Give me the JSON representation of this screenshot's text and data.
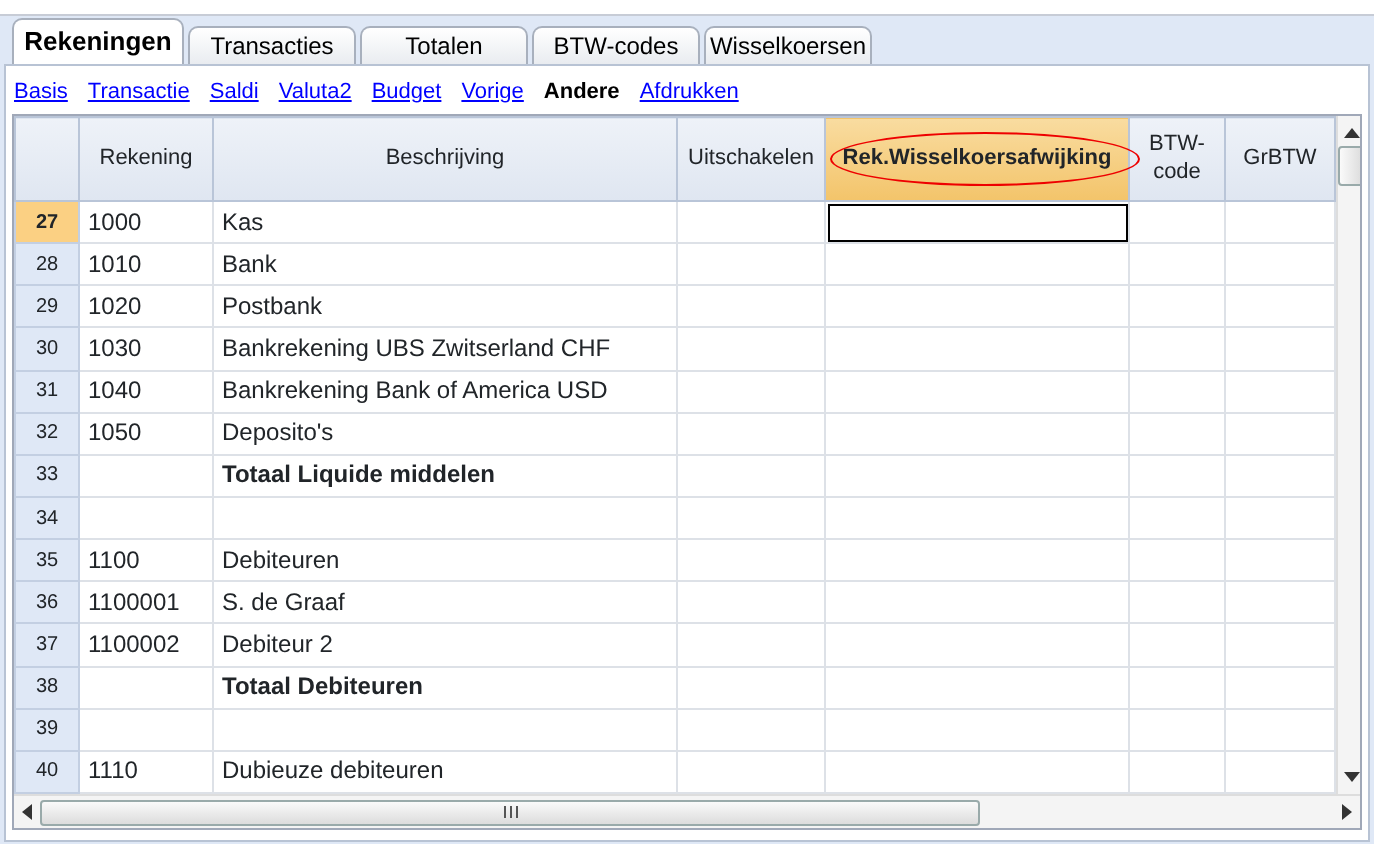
{
  "tabs": [
    {
      "label": "Rekeningen",
      "selected": true
    },
    {
      "label": "Transacties",
      "selected": false
    },
    {
      "label": "Totalen",
      "selected": false
    },
    {
      "label": "BTW-codes",
      "selected": false
    },
    {
      "label": "Wisselkoersen",
      "selected": false
    }
  ],
  "views": [
    {
      "label": "Basis",
      "selected": false
    },
    {
      "label": "Transactie",
      "selected": false
    },
    {
      "label": "Saldi",
      "selected": false
    },
    {
      "label": "Valuta2",
      "selected": false
    },
    {
      "label": "Budget",
      "selected": false
    },
    {
      "label": "Vorige",
      "selected": false
    },
    {
      "label": "Andere",
      "selected": true
    },
    {
      "label": "Afdrukken",
      "selected": false
    }
  ],
  "table": {
    "columns": [
      {
        "label": "Rekening",
        "selected": false,
        "highlighted": false
      },
      {
        "label": "Beschrijving",
        "selected": false,
        "highlighted": false
      },
      {
        "label": "Uitschakelen",
        "selected": false,
        "highlighted": false
      },
      {
        "label": "Rek.Wisselkoersafwijking",
        "selected": true,
        "highlighted": true
      },
      {
        "label": "BTW-\ncode",
        "selected": false,
        "highlighted": false
      },
      {
        "label": "GrBTW",
        "selected": false,
        "highlighted": false
      }
    ],
    "rows": [
      {
        "number": "27",
        "account": "1000",
        "description": "Kas",
        "kind": "normal",
        "selected": true
      },
      {
        "number": "28",
        "account": "1010",
        "description": "Bank",
        "kind": "normal",
        "selected": false
      },
      {
        "number": "29",
        "account": "1020",
        "description": "Postbank",
        "kind": "normal",
        "selected": false
      },
      {
        "number": "30",
        "account": "1030",
        "description": "Bankrekening UBS Zwitserland CHF",
        "kind": "normal",
        "selected": false
      },
      {
        "number": "31",
        "account": "1040",
        "description": "Bankrekening Bank of America USD",
        "kind": "normal",
        "selected": false
      },
      {
        "number": "32",
        "account": "1050",
        "description": "Deposito's",
        "kind": "normal",
        "selected": false
      },
      {
        "number": "33",
        "account": "",
        "description": "Totaal Liquide middelen",
        "kind": "total",
        "selected": false
      },
      {
        "number": "34",
        "account": "",
        "description": "",
        "kind": "normal",
        "selected": false
      },
      {
        "number": "35",
        "account": "1100",
        "description": "Debiteuren",
        "kind": "normal",
        "selected": false
      },
      {
        "number": "36",
        "account": "1100001",
        "description": "S. de Graaf",
        "kind": "normal",
        "selected": false
      },
      {
        "number": "37",
        "account": "1100002",
        "description": "Debiteur 2",
        "kind": "normal",
        "selected": false
      },
      {
        "number": "38",
        "account": "",
        "description": "Totaal Debiteuren",
        "kind": "total",
        "selected": false
      },
      {
        "number": "39",
        "account": "",
        "description": "",
        "kind": "normal",
        "selected": false
      },
      {
        "number": "40",
        "account": "1110",
        "description": "Dubieuze debiteuren",
        "kind": "normal",
        "selected": false
      }
    ]
  }
}
